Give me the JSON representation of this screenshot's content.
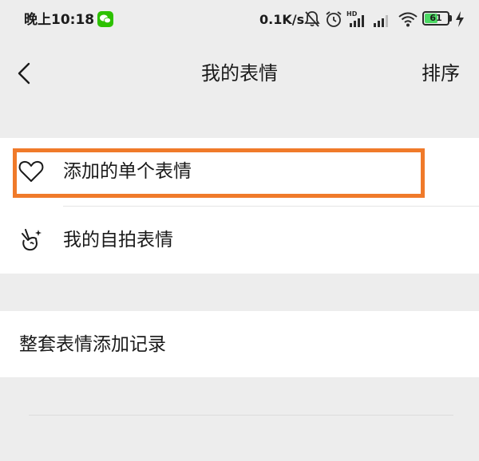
{
  "status_bar": {
    "time": "晚上10:18",
    "network_speed": "0.1K/s",
    "battery_level": "61",
    "battery_fraction": 0.61,
    "icons": [
      "wechat-icon",
      "mute-bell-icon",
      "alarm-icon",
      "hd-signal-icon",
      "signal-icon",
      "wifi-icon",
      "battery-icon",
      "charging-icon"
    ]
  },
  "nav": {
    "back_icon": "chevron-left-icon",
    "title": "我的表情",
    "action_label": "排序"
  },
  "menu": {
    "items": [
      {
        "label": "添加的单个表情",
        "icon": "heart-outline-icon"
      },
      {
        "label": "我的自拍表情",
        "icon": "peace-hand-icon"
      }
    ]
  },
  "records": {
    "label": "整套表情添加记录"
  },
  "colors": {
    "background": "#ededed",
    "card": "#ffffff",
    "highlight": "#f07a2a",
    "wechat_green": "#2dc100",
    "battery_green": "#4cd964"
  }
}
